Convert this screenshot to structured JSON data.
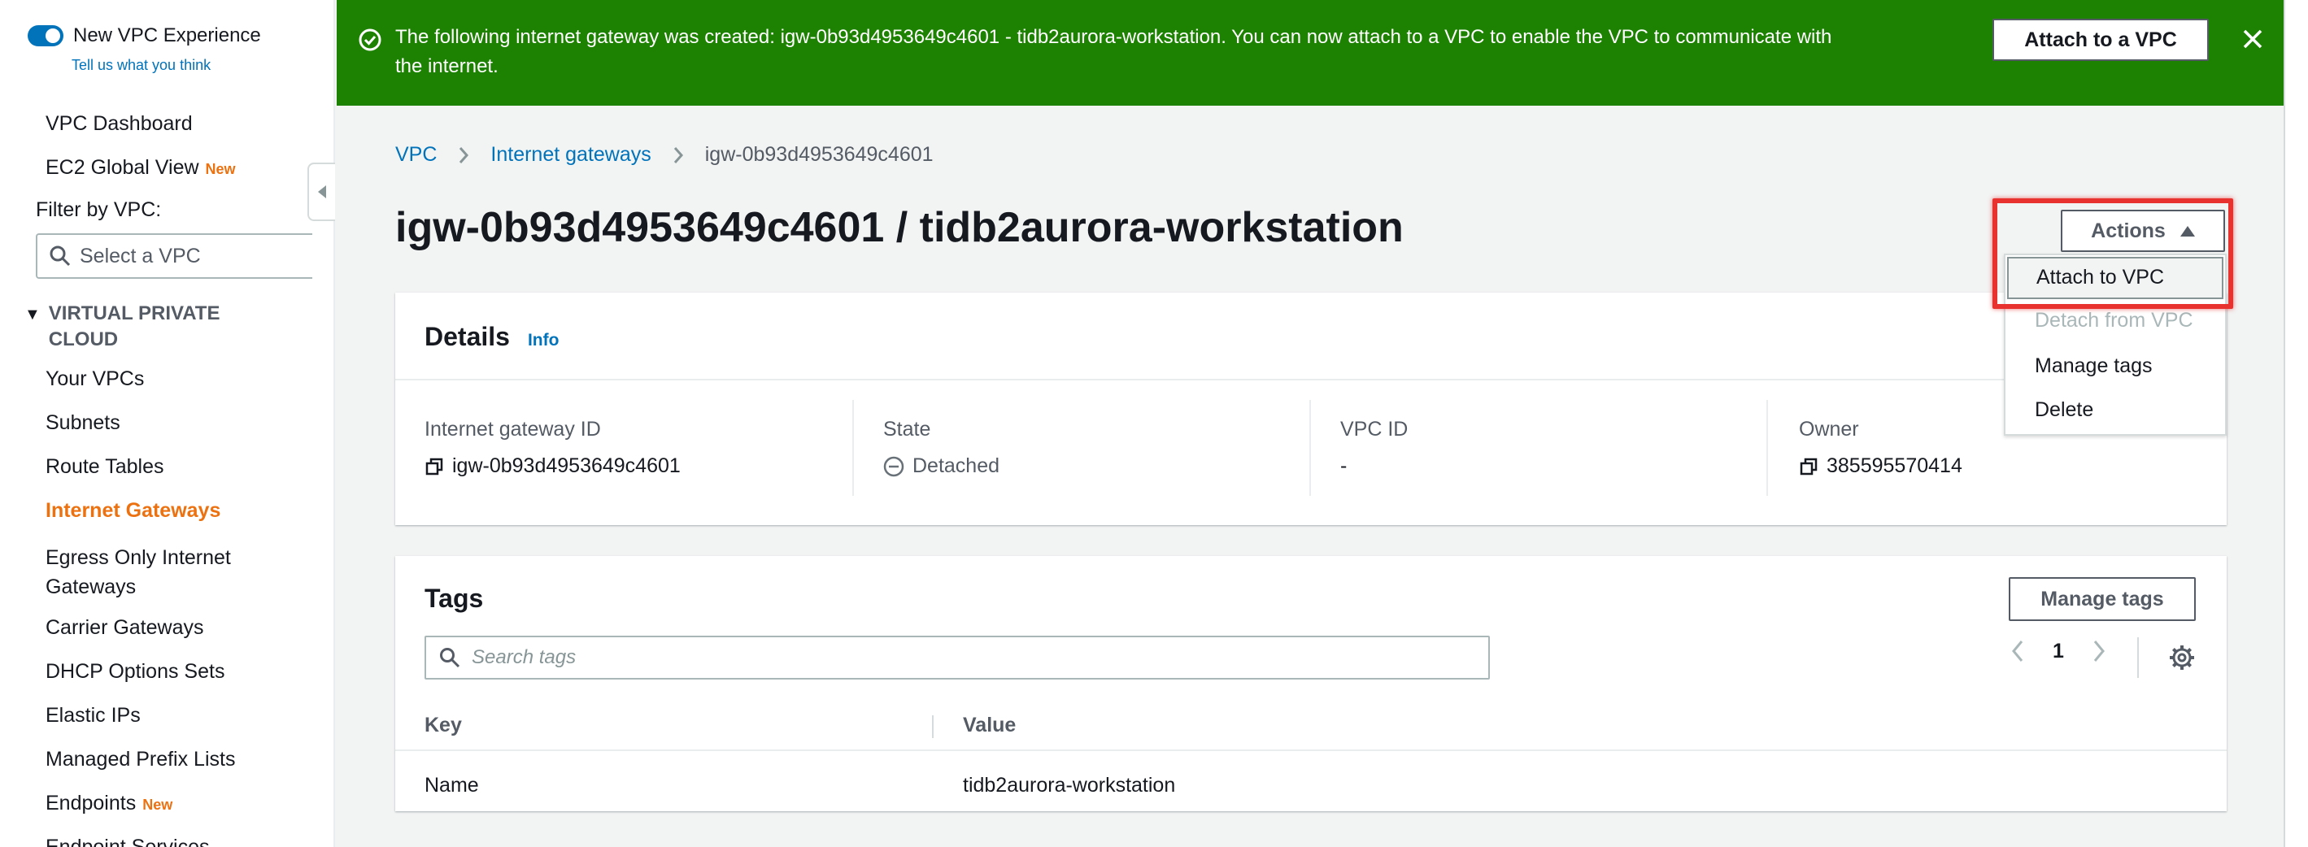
{
  "sidebar": {
    "toggle_label": "New VPC Experience",
    "feedback_link": "Tell us what you think",
    "items_top": [
      {
        "label": "VPC Dashboard",
        "badge": ""
      },
      {
        "label": "EC2 Global View",
        "badge": "New"
      }
    ],
    "filter_label": "Filter by VPC:",
    "vpc_select_placeholder": "Select a VPC",
    "section_title": "VIRTUAL PRIVATE CLOUD",
    "items": [
      {
        "label": "Your VPCs",
        "badge": ""
      },
      {
        "label": "Subnets",
        "badge": ""
      },
      {
        "label": "Route Tables",
        "badge": ""
      },
      {
        "label": "Internet Gateways",
        "badge": "",
        "active": true
      },
      {
        "label": "Egress Only Internet Gateways",
        "badge": ""
      },
      {
        "label": "Carrier Gateways",
        "badge": ""
      },
      {
        "label": "DHCP Options Sets",
        "badge": ""
      },
      {
        "label": "Elastic IPs",
        "badge": ""
      },
      {
        "label": "Managed Prefix Lists",
        "badge": ""
      },
      {
        "label": "Endpoints",
        "badge": "New"
      },
      {
        "label": "Endpoint Services",
        "badge": ""
      }
    ]
  },
  "flash": {
    "message_line1": "The following internet gateway was created: igw-0b93d4953649c4601 - tidb2aurora-workstation. You can now attach to a VPC to enable the VPC to communicate with",
    "message_line2": "the internet.",
    "button_label": "Attach to a VPC",
    "color": "#1d8102"
  },
  "breadcrumb": {
    "items": [
      "VPC",
      "Internet gateways"
    ],
    "current": "igw-0b93d4953649c4601"
  },
  "page_title": "igw-0b93d4953649c4601 / tidb2aurora-workstation",
  "actions": {
    "button_label": "Actions",
    "menu": [
      {
        "label": "Attach to VPC",
        "disabled": false
      },
      {
        "label": "Detach from VPC",
        "disabled": true
      },
      {
        "label": "Manage tags",
        "disabled": false
      },
      {
        "label": "Delete",
        "disabled": false
      }
    ]
  },
  "details": {
    "title": "Details",
    "info_link": "Info",
    "fields": [
      {
        "label": "Internet gateway ID",
        "value": "igw-0b93d4953649c4601",
        "icon": "copy-icon"
      },
      {
        "label": "State",
        "value": "Detached",
        "icon": "stopped-status-icon"
      },
      {
        "label": "VPC ID",
        "value": "-",
        "icon": ""
      },
      {
        "label": "Owner",
        "value": "385595570414",
        "icon": "copy-icon"
      }
    ]
  },
  "tags": {
    "title": "Tags",
    "manage_button": "Manage tags",
    "search_placeholder": "Search tags",
    "page": "1",
    "columns": [
      "Key",
      "Value"
    ],
    "rows": [
      {
        "key": "Name",
        "value": "tidb2aurora-workstation"
      }
    ]
  },
  "colors": {
    "accent": "#0073bb",
    "active_nav": "#ec7211",
    "highlight": "#e8322f"
  }
}
